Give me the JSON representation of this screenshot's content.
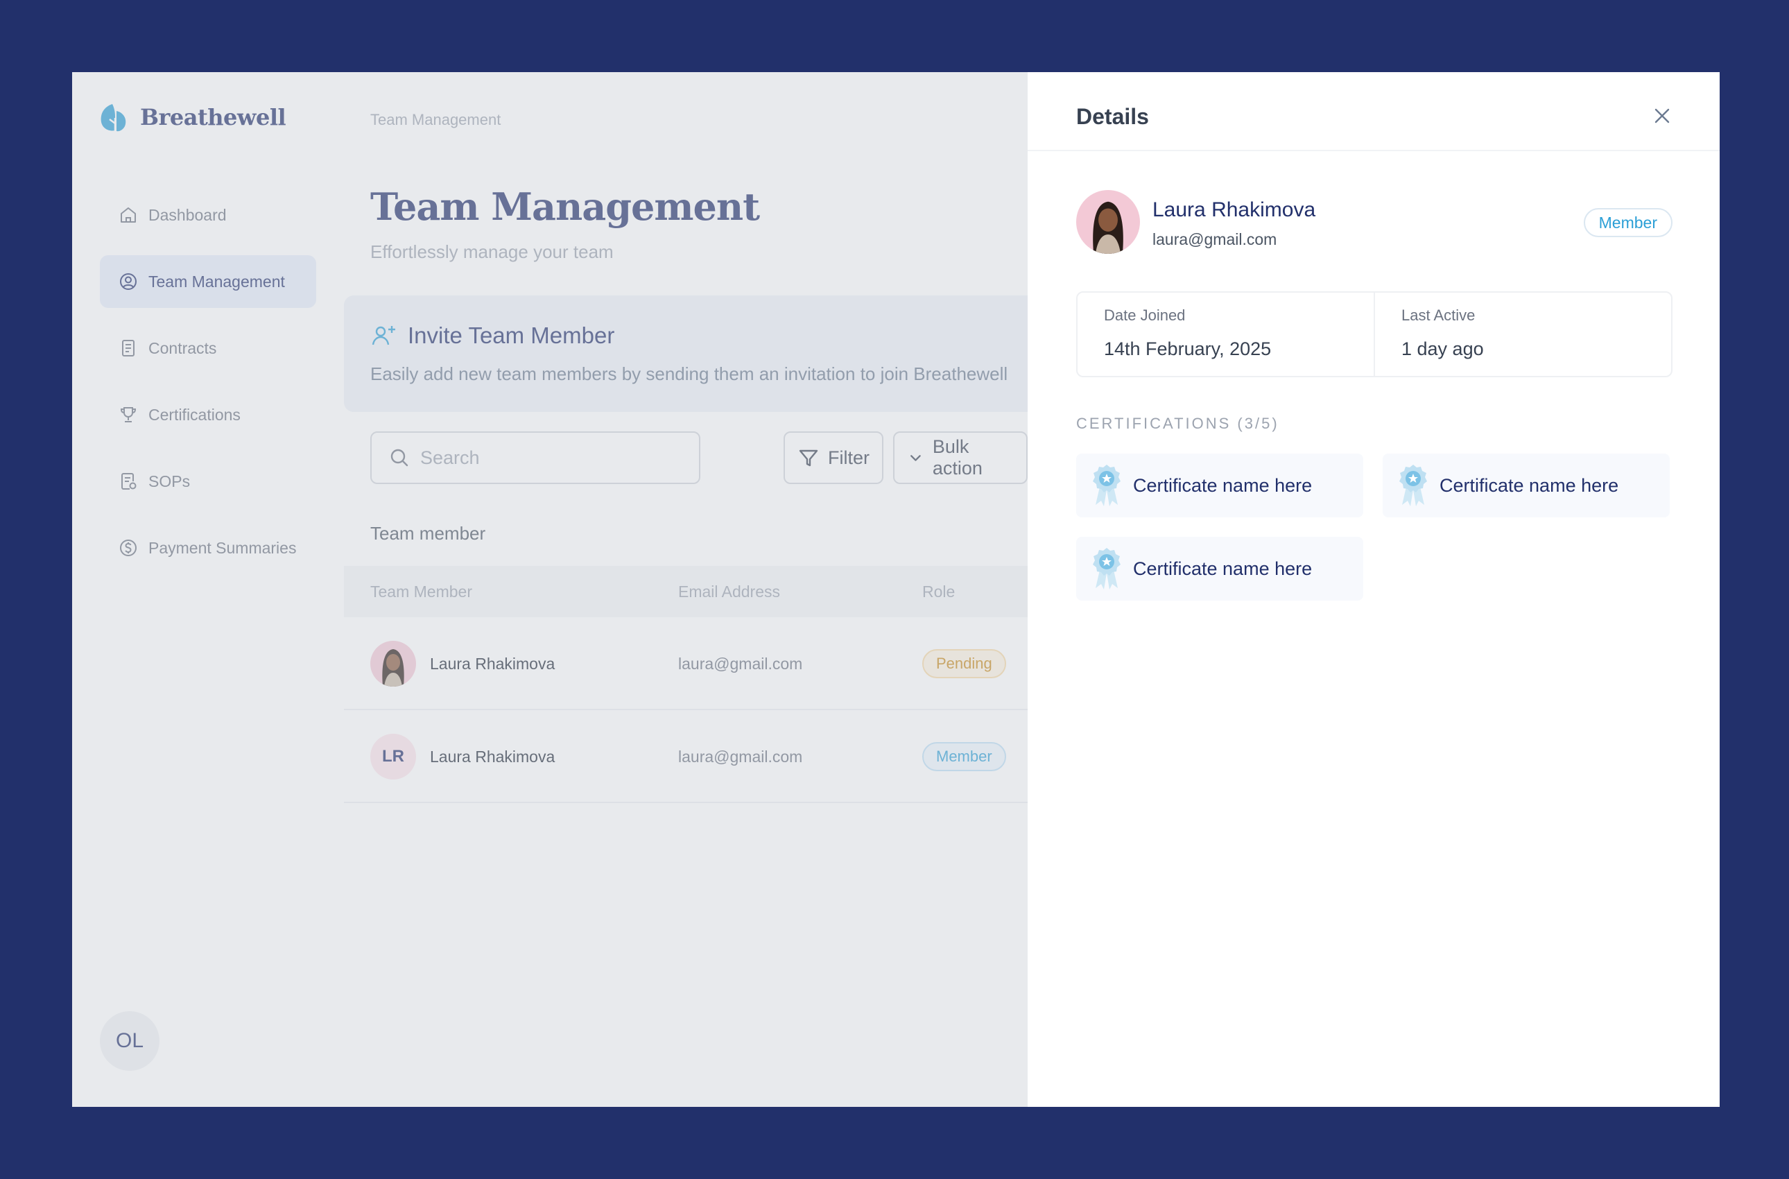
{
  "app": {
    "brand": "Breathewell"
  },
  "sidebar": {
    "items": [
      {
        "label": "Dashboard",
        "icon": "home-icon",
        "active": false
      },
      {
        "label": "Team Management",
        "icon": "user-circle-icon",
        "active": true
      },
      {
        "label": "Contracts",
        "icon": "document-icon",
        "active": false
      },
      {
        "label": "Certifications",
        "icon": "trophy-icon",
        "active": false
      },
      {
        "label": "SOPs",
        "icon": "document-check-icon",
        "active": false
      },
      {
        "label": "Payment Summaries",
        "icon": "dollar-circle-icon",
        "active": false
      }
    ],
    "user_initials": "OL"
  },
  "main": {
    "breadcrumb": "Team Management",
    "title": "Team Management",
    "subtitle": "Effortlessly manage your team",
    "invite": {
      "title": "Invite Team Member",
      "description": "Easily add new team members by sending them an invitation to join Breathewell"
    },
    "search": {
      "placeholder": "Search"
    },
    "filter_label": "Filter",
    "bulk_action_label": "Bulk action",
    "section_label": "Team member",
    "table": {
      "columns": [
        "Team Member",
        "Email Address",
        "Role"
      ],
      "rows": [
        {
          "name": "Laura Rhakimova",
          "email": "laura@gmail.com",
          "role": "Pending",
          "avatar": "photo"
        },
        {
          "name": "Laura Rhakimova",
          "email": "laura@gmail.com",
          "role": "Member",
          "avatar": "LR"
        }
      ]
    }
  },
  "details": {
    "title": "Details",
    "profile": {
      "name": "Laura Rhakimova",
      "email": "laura@gmail.com",
      "role": "Member"
    },
    "date_joined_label": "Date Joined",
    "date_joined_value": "14th February, 2025",
    "last_active_label": "Last Active",
    "last_active_value": "1 day ago",
    "certifications_heading": "CERTIFICATIONS (3/5)",
    "certifications": [
      {
        "name": "Certificate name here"
      },
      {
        "name": "Certificate name here"
      },
      {
        "name": "Certificate name here"
      }
    ]
  },
  "colors": {
    "background": "#22306b",
    "brand_navy": "#22306b",
    "accent_blue": "#2b9fd6",
    "pending_orange": "#c98a1a"
  }
}
